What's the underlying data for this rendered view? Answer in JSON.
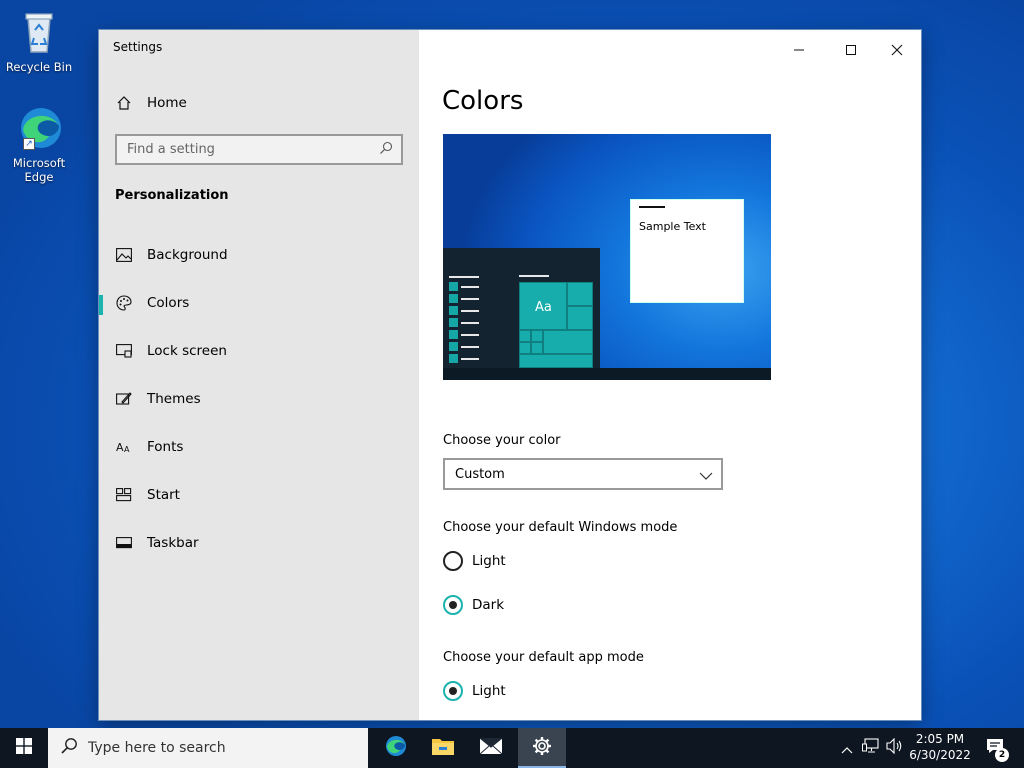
{
  "desktop": {
    "icons": [
      {
        "label": "Recycle Bin"
      },
      {
        "label": "Microsoft Edge"
      }
    ]
  },
  "window": {
    "title": "Settings",
    "sidebar": {
      "home_label": "Home",
      "search_placeholder": "Find a setting",
      "section": "Personalization",
      "items": [
        {
          "label": "Background",
          "icon": "picture-icon"
        },
        {
          "label": "Colors",
          "icon": "palette-icon",
          "active": true
        },
        {
          "label": "Lock screen",
          "icon": "lock-screen-icon"
        },
        {
          "label": "Themes",
          "icon": "themes-icon"
        },
        {
          "label": "Fonts",
          "icon": "fonts-icon"
        },
        {
          "label": "Start",
          "icon": "start-icon"
        },
        {
          "label": "Taskbar",
          "icon": "taskbar-icon"
        }
      ]
    },
    "content": {
      "title": "Colors",
      "preview": {
        "sample_text": "Sample Text",
        "tile_label": "Aa"
      },
      "choose_color": {
        "label": "Choose your color",
        "value": "Custom"
      },
      "windows_mode": {
        "label": "Choose your default Windows mode",
        "options": [
          {
            "label": "Light",
            "selected": false
          },
          {
            "label": "Dark",
            "selected": true
          }
        ]
      },
      "app_mode": {
        "label": "Choose your default app mode",
        "options": [
          {
            "label": "Light",
            "selected": true
          }
        ]
      }
    }
  },
  "taskbar": {
    "search_placeholder": "Type here to search",
    "time": "2:05 PM",
    "date": "6/30/2022",
    "notification_count": "2"
  },
  "colors": {
    "accent": "#1bb3ad",
    "taskbar_bg": "#0e1621",
    "sidebar_bg": "#e6e6e6"
  }
}
